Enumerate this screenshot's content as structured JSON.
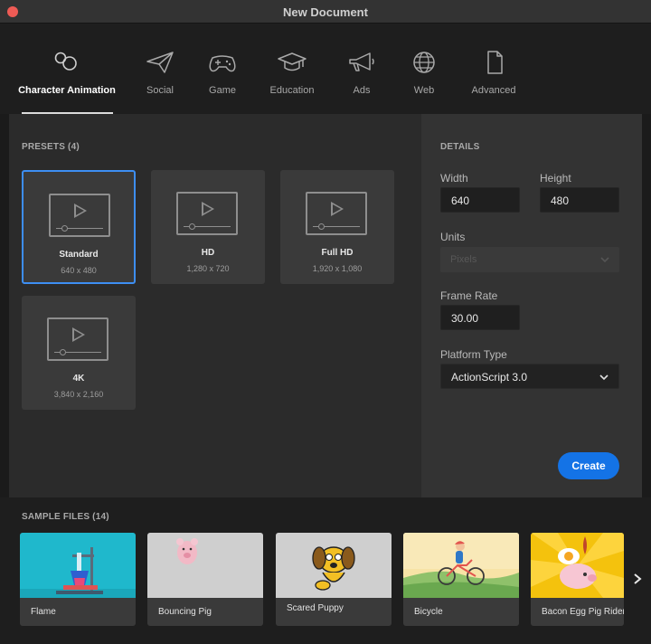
{
  "window": {
    "title": "New Document"
  },
  "tabs": [
    {
      "label": "Character Animation",
      "icon": "character-animation-icon",
      "active": true
    },
    {
      "label": "Social",
      "icon": "paper-plane-icon"
    },
    {
      "label": "Game",
      "icon": "gamepad-icon"
    },
    {
      "label": "Education",
      "icon": "graduation-cap-icon"
    },
    {
      "label": "Ads",
      "icon": "megaphone-icon"
    },
    {
      "label": "Web",
      "icon": "globe-icon"
    },
    {
      "label": "Advanced",
      "icon": "document-icon"
    }
  ],
  "presets": {
    "heading": "PRESETS (4)",
    "items": [
      {
        "name": "Standard",
        "size": "640 x 480",
        "selected": true
      },
      {
        "name": "HD",
        "size": "1,280 x 720"
      },
      {
        "name": "Full HD",
        "size": "1,920 x 1,080"
      },
      {
        "name": "4K",
        "size": "3,840 x 2,160"
      }
    ]
  },
  "details": {
    "heading": "DETAILS",
    "width_label": "Width",
    "width_value": "640",
    "height_label": "Height",
    "height_value": "480",
    "units_label": "Units",
    "units_value": "Pixels",
    "frame_rate_label": "Frame Rate",
    "frame_rate_value": "30.00",
    "platform_label": "Platform Type",
    "platform_value": "ActionScript 3.0",
    "create_label": "Create"
  },
  "samples": {
    "heading": "SAMPLE FILES (14)",
    "items": [
      {
        "label": "Flame"
      },
      {
        "label": "Bouncing Pig"
      },
      {
        "label": "Scared Puppy"
      },
      {
        "label": "Bicycle"
      },
      {
        "label": "Bacon Egg Pig Rider"
      }
    ]
  },
  "colors": {
    "accent": "#1473e6",
    "selection": "#3d8ef2",
    "close": "#ee5b55"
  }
}
